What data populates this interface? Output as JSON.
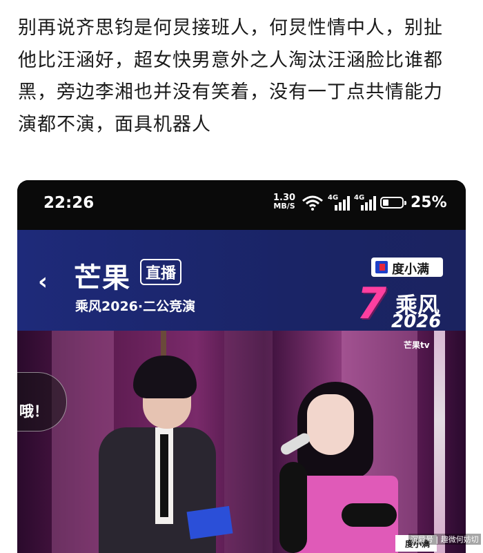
{
  "post": {
    "lines": [
      "别再说齐思钧是何炅接班人，何炅性情中人，别扯",
      "他比汪涵好，超女快男意外之人淘汰汪涵脸比谁都",
      "黑，旁边李湘也并没有笑着，没有一丁点共情能力",
      "演都不演，面具机器人"
    ]
  },
  "statusbar": {
    "time": "22:26",
    "speed_value": "1.30",
    "speed_unit": "MB/S",
    "network1": "4G",
    "network2": "4G",
    "battery_percent": "25%",
    "battery_level": 0.25
  },
  "header": {
    "back_icon": "chevron-left-icon",
    "brand": "芒果",
    "live_badge": "直播",
    "subtitle": "乘风2026·二公竞演",
    "sponsor": "度小满",
    "show_number": "7",
    "show_name": "乘风",
    "show_year": "2026"
  },
  "video": {
    "toast_text": "哦！",
    "channel_watermark": "芒果tv",
    "sponsor_small": "度小满"
  },
  "credit": "沉异号 | 趣微何妨切",
  "colors": {
    "header_bg": "#1e2a7a",
    "accent_pink": "#ff3fa0",
    "status_bg": "#0a0a0a"
  }
}
